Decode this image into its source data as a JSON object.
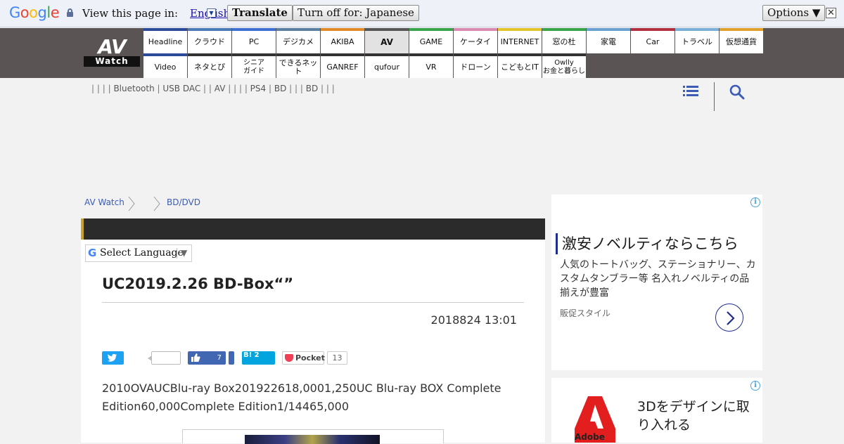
{
  "translate_bar": {
    "logo_letters": [
      "G",
      "o",
      "o",
      "g",
      "l",
      "e"
    ],
    "logo_colors": [
      "#4285f4",
      "#ea4335",
      "#fbbc05",
      "#4285f4",
      "#34a853",
      "#ea4335"
    ],
    "view_label": "View this page in:",
    "language": "English",
    "translate_button": "Translate",
    "turn_off_button": "Turn off for: Japanese",
    "options_button": "Options ▼",
    "close_icon": "✕"
  },
  "site": {
    "logo_top": "AV",
    "logo_bottom": "Watch"
  },
  "nav": {
    "row1": [
      {
        "label": "Headline",
        "color": "#2b4a9a"
      },
      {
        "label": "クラウド",
        "color": "#4a7ab5"
      },
      {
        "label": "PC",
        "color": "#3f6fd0"
      },
      {
        "label": "デジカメ",
        "color": "#5a7fa0"
      },
      {
        "label": "AKIBA",
        "color": "#e08a2a"
      },
      {
        "label": "AV",
        "color": "#555555",
        "active": true
      },
      {
        "label": "GAME",
        "color": "#3aa44a"
      },
      {
        "label": "ケータイ",
        "color": "#d88ab0"
      },
      {
        "label": "INTERNET",
        "color": "#e0c42a"
      },
      {
        "label": "窓の杜",
        "color": "#3aa44a"
      },
      {
        "label": "家電",
        "color": "#6aa0d0"
      },
      {
        "label": "Car",
        "color": "#b03040"
      },
      {
        "label": "トラベル",
        "color": "#7ab0d8"
      },
      {
        "label": "仮想通貨",
        "color": "#e0a02a"
      }
    ],
    "row2": [
      {
        "label": "Video",
        "color": "#2b4a9a"
      },
      {
        "label": "ネタとぴ",
        "color": "#333333"
      },
      {
        "label": "シニア\nガイド",
        "color": "#333333"
      },
      {
        "label": "できるネット",
        "color": "#333333"
      },
      {
        "label": "GANREF",
        "color": "#333333"
      },
      {
        "label": "qufour",
        "color": "#333333"
      },
      {
        "label": "VR",
        "color": "#333333"
      },
      {
        "label": "ドローン",
        "color": "#333333"
      },
      {
        "label": "こどもとIT",
        "color": "#333333"
      },
      {
        "label": "Owlly\nお金と暮らし",
        "color": "#333333"
      }
    ]
  },
  "subnav": {
    "items": [
      "",
      "",
      "",
      "",
      "Bluetooth",
      "USB DAC",
      "",
      "AV",
      "",
      "",
      "",
      "PS4",
      "BD",
      "",
      "",
      "BD",
      "",
      "",
      ""
    ]
  },
  "breadcrumb": {
    "items": [
      "AV Watch",
      "",
      "BD/DVD"
    ]
  },
  "article": {
    "language_select": "Select Language",
    "title": "UC2019.2.26 BD-Box“”",
    "date": "2018824 13:01",
    "like_count": "7",
    "hatena_label": "B! 2",
    "pocket_label": "Pocket",
    "pocket_count": "13",
    "body": "2010OVAUCBlu-ray Box201922618,0001,250UC Blu-ray BOX Complete Edition60,000Complete Edition1/14465,000"
  },
  "ads": {
    "ad1": {
      "title": "激安ノベルティならこちら",
      "desc": "人気のトートバッグ、ステーショナリー、カスタムタンブラー等 名入れノベルティの品揃えが豊富",
      "source": "販促スタイル"
    },
    "ad2": {
      "title": "3Dをデザインに取り入れる",
      "logo_text": "Adobe"
    },
    "info_icon": "i"
  }
}
